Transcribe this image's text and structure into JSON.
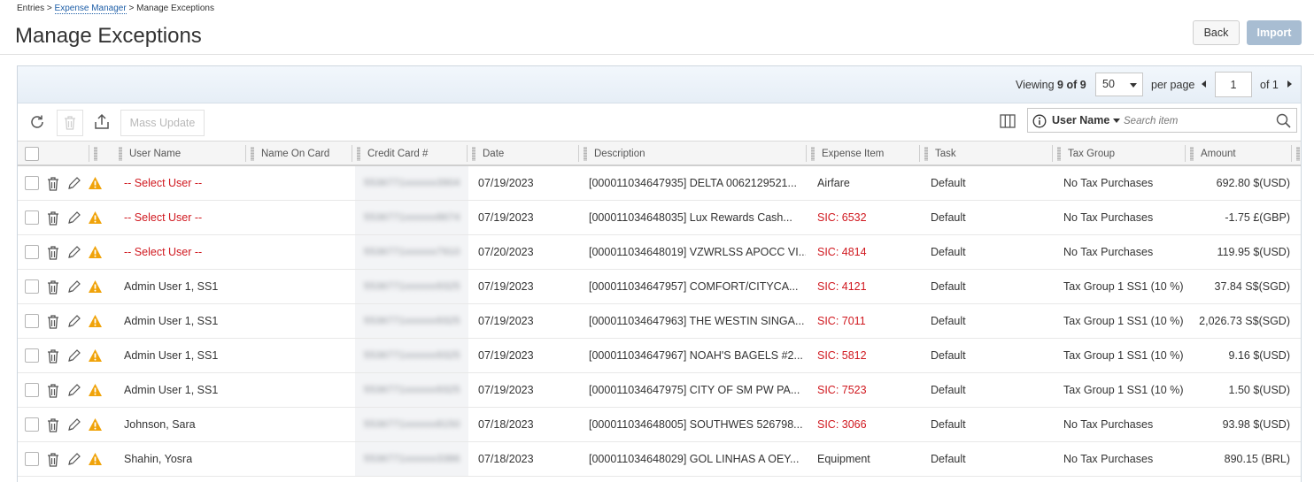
{
  "breadcrumb": {
    "root": "Entries",
    "sep": ">",
    "link": "Expense Manager",
    "current": "Manage Exceptions"
  },
  "page": {
    "title": "Manage Exceptions",
    "back_label": "Back",
    "import_label": "Import"
  },
  "pager": {
    "viewing_label": "Viewing",
    "viewing_count": "9 of 9",
    "page_size": "50",
    "per_page_label": "per page",
    "current_page": "1",
    "of_label": "of 1"
  },
  "toolbar": {
    "mass_update_label": "Mass Update",
    "search_field": "User Name",
    "search_placeholder": "Search item"
  },
  "columns": [
    "User Name",
    "Name On Card",
    "Credit Card #",
    "Date",
    "Description",
    "Expense Item",
    "Task",
    "Tax Group",
    "Amount"
  ],
  "rows": [
    {
      "user": "-- Select User --",
      "user_red": true,
      "card": "5536771xxxxxx3904",
      "date": "07/19/2023",
      "description": "[000011034647935] DELTA 0062129521...",
      "item": "Airfare",
      "item_red": false,
      "task": "Default",
      "tax": "No Tax Purchases",
      "amount": "692.80 $(USD)"
    },
    {
      "user": "-- Select User --",
      "user_red": true,
      "card": "5536771xxxxxx8674",
      "date": "07/19/2023",
      "description": "[000011034648035] Lux Rewards Cash...",
      "item": "SIC: 6532",
      "item_red": true,
      "task": "Default",
      "tax": "No Tax Purchases",
      "amount": "-1.75 £(GBP)"
    },
    {
      "user": "-- Select User --",
      "user_red": true,
      "card": "5536771xxxxxx7910",
      "date": "07/20/2023",
      "description": "[000011034648019] VZWRLSS APOCC VI...",
      "item": "SIC: 4814",
      "item_red": true,
      "task": "Default",
      "tax": "No Tax Purchases",
      "amount": "119.95 $(USD)"
    },
    {
      "user": "Admin User 1, SS1",
      "user_red": false,
      "card": "5536771xxxxxx9325",
      "date": "07/19/2023",
      "description": "[000011034647957] COMFORT/CITYCA...",
      "item": "SIC: 4121",
      "item_red": true,
      "task": "Default",
      "tax": "Tax Group 1 SS1 (10 %)",
      "amount": "37.84 S$(SGD)"
    },
    {
      "user": "Admin User 1, SS1",
      "user_red": false,
      "card": "5536771xxxxxx9325",
      "date": "07/19/2023",
      "description": "[000011034647963] THE WESTIN SINGA...",
      "item": "SIC: 7011",
      "item_red": true,
      "task": "Default",
      "tax": "Tax Group 1 SS1 (10 %)",
      "amount": "2,026.73 S$(SGD)"
    },
    {
      "user": "Admin User 1, SS1",
      "user_red": false,
      "card": "5536771xxxxxx9325",
      "date": "07/19/2023",
      "description": "[000011034647967] NOAH'S BAGELS #2...",
      "item": "SIC: 5812",
      "item_red": true,
      "task": "Default",
      "tax": "Tax Group 1 SS1 (10 %)",
      "amount": "9.16 $(USD)"
    },
    {
      "user": "Admin User 1, SS1",
      "user_red": false,
      "card": "5536771xxxxxx9325",
      "date": "07/19/2023",
      "description": "[000011034647975] CITY OF SM PW PA...",
      "item": "SIC: 7523",
      "item_red": true,
      "task": "Default",
      "tax": "Tax Group 1 SS1 (10 %)",
      "amount": "1.50 $(USD)"
    },
    {
      "user": "Johnson, Sara",
      "user_red": false,
      "card": "5536771xxxxxx8150",
      "date": "07/18/2023",
      "description": "[000011034648005] SOUTHWES 526798...",
      "item": "SIC: 3066",
      "item_red": true,
      "task": "Default",
      "tax": "No Tax Purchases",
      "amount": "93.98 $(USD)"
    },
    {
      "user": "Shahin, Yosra",
      "user_red": false,
      "card": "5536771xxxxxx3386",
      "date": "07/18/2023",
      "description": "[000011034648029] GOL LINHAS A OEY...",
      "item": "Equipment",
      "item_red": false,
      "task": "Default",
      "tax": "No Tax Purchases",
      "amount": "890.15 (BRL)"
    }
  ],
  "colors": {
    "link": "#1f5fa8",
    "error_red": "#d0181f",
    "warning_orange": "#f0a30a",
    "import_disabled": "#a8bdd2"
  },
  "icons": {
    "row_delete": "trash-icon",
    "row_edit": "pencil-icon",
    "row_warning": "warning-icon",
    "refresh": "refresh-icon",
    "export": "export-icon",
    "columns": "columns-icon",
    "info": "info-icon",
    "search": "search-icon"
  }
}
